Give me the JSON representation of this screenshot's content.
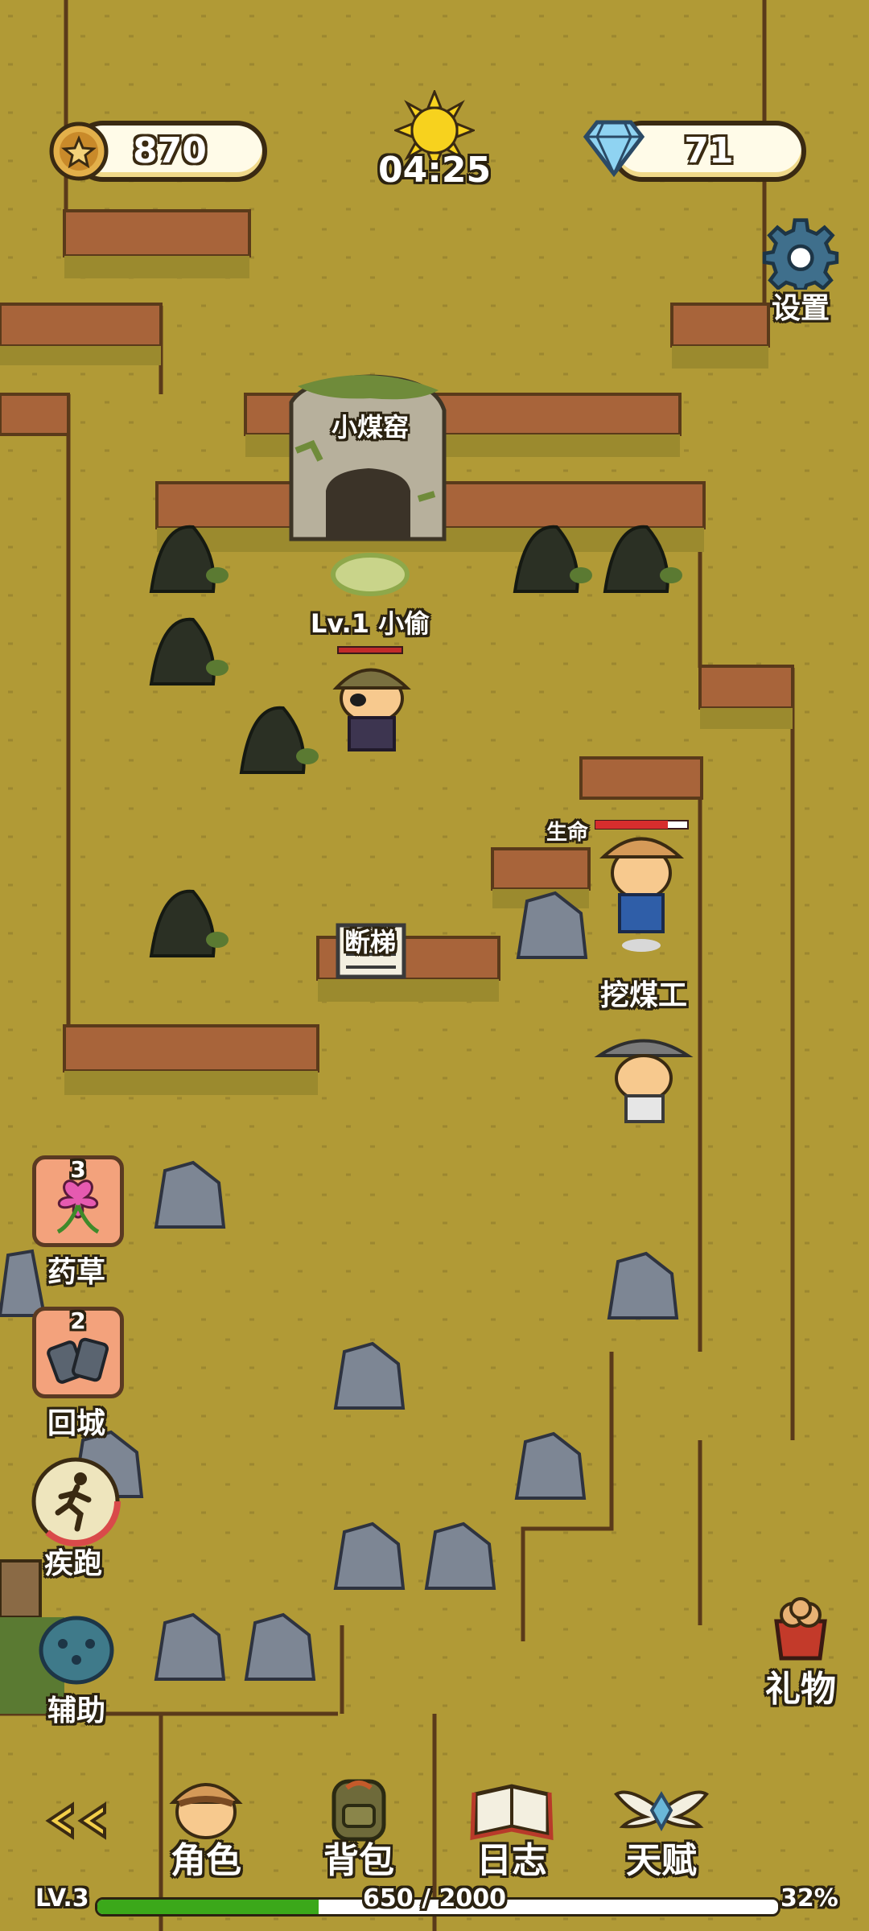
{
  "hud": {
    "coins": "870",
    "gems": "71",
    "time": "04:25",
    "settings_label": "设置"
  },
  "map_labels": {
    "cave": "小煤窑",
    "enemy": "Lv.1 小偷",
    "ladder": "断梯",
    "npc_miner": "挖煤工",
    "npc_hp_label": "生命"
  },
  "side_items": [
    {
      "label": "药草",
      "count": "3",
      "icon": "herb-icon"
    },
    {
      "label": "回城",
      "count": "2",
      "icon": "logs-icon"
    },
    {
      "label": "疾跑",
      "icon": "sprint-icon"
    },
    {
      "label": "辅助",
      "icon": "assist-icon"
    }
  ],
  "gift_label": "礼物",
  "bottom_nav": [
    {
      "label": "角色",
      "icon": "character-icon"
    },
    {
      "label": "背包",
      "icon": "backpack-icon"
    },
    {
      "label": "日志",
      "icon": "journal-icon"
    },
    {
      "label": "天赋",
      "icon": "talent-icon"
    }
  ],
  "xp": {
    "level": "LV.3",
    "text": "650 / 2000",
    "percent_label": "32%",
    "fraction": 0.325
  },
  "colors": {
    "ground": "#b19a36",
    "cliff": "#a8643a",
    "xp_bar": "#3ba81a"
  }
}
